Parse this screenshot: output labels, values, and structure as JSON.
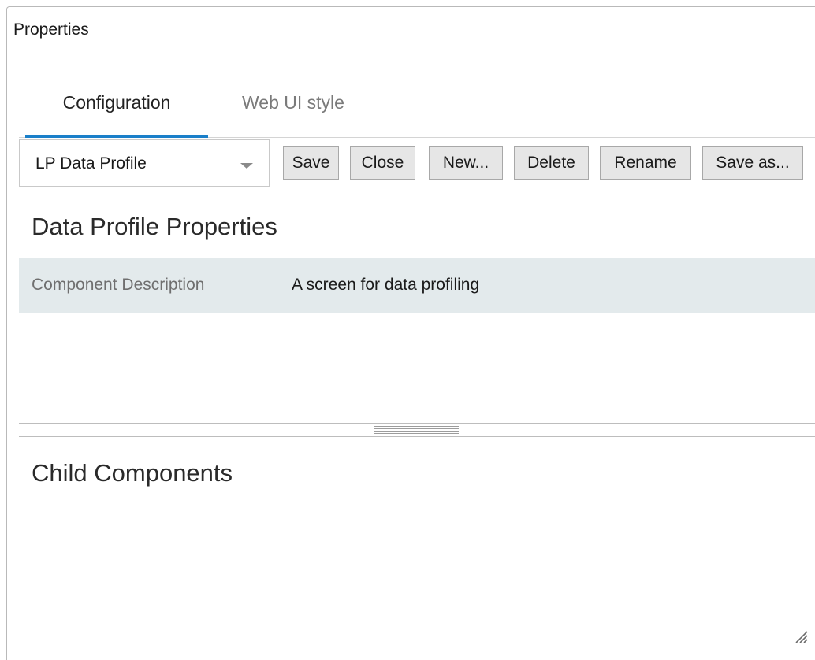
{
  "panel": {
    "title": "Properties"
  },
  "tabs": [
    {
      "label": "Configuration",
      "active": true
    },
    {
      "label": "Web UI style",
      "active": false
    }
  ],
  "toolbar": {
    "profile_select": {
      "selected": "LP Data Profile"
    },
    "buttons": {
      "save": "Save",
      "close": "Close",
      "new": "New...",
      "delete": "Delete",
      "rename": "Rename",
      "save_as": "Save as..."
    }
  },
  "data_profile_properties": {
    "title": "Data Profile Properties",
    "rows": [
      {
        "label": "Component Description",
        "value": "A screen for data profiling"
      }
    ]
  },
  "child_components": {
    "title": "Child Components"
  },
  "colors": {
    "accent": "#1a7fc9",
    "row_highlight": "#e3eaec",
    "button_bg": "#e6e6e6"
  },
  "icons": {
    "dropdown": "chevron-down-icon",
    "splitter": "splitter-grip-icon",
    "resize": "resize-grip-icon"
  }
}
